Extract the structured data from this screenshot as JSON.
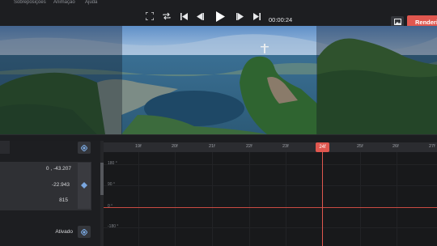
{
  "menu": {
    "items": [
      "Sobreposições",
      "Animação",
      "Ajuda"
    ]
  },
  "toolbar": {
    "timecode": "00:00:24",
    "render_label": "Renderizar",
    "icons": [
      "fullscreen-icon",
      "loop-icon",
      "skip-start-icon",
      "step-back-icon",
      "play-icon",
      "step-forward-icon",
      "skip-end-icon",
      "image-icon"
    ]
  },
  "timeline": {
    "frames": [
      "19f",
      "20f",
      "21f",
      "22f",
      "23f",
      "25f",
      "26f",
      "27f"
    ],
    "current_frame": "24f",
    "y_axis": [
      "180 °",
      "90 °",
      "0 °",
      "-180 °"
    ]
  },
  "properties": {
    "position_value": "0 , -43.207",
    "second_value": "-22.943",
    "third_value": "815",
    "toggle_label": "Ativado"
  },
  "colors": {
    "accent": "#e0574f",
    "keyframe": "#7aa7e0",
    "background": "#1c1d20"
  }
}
